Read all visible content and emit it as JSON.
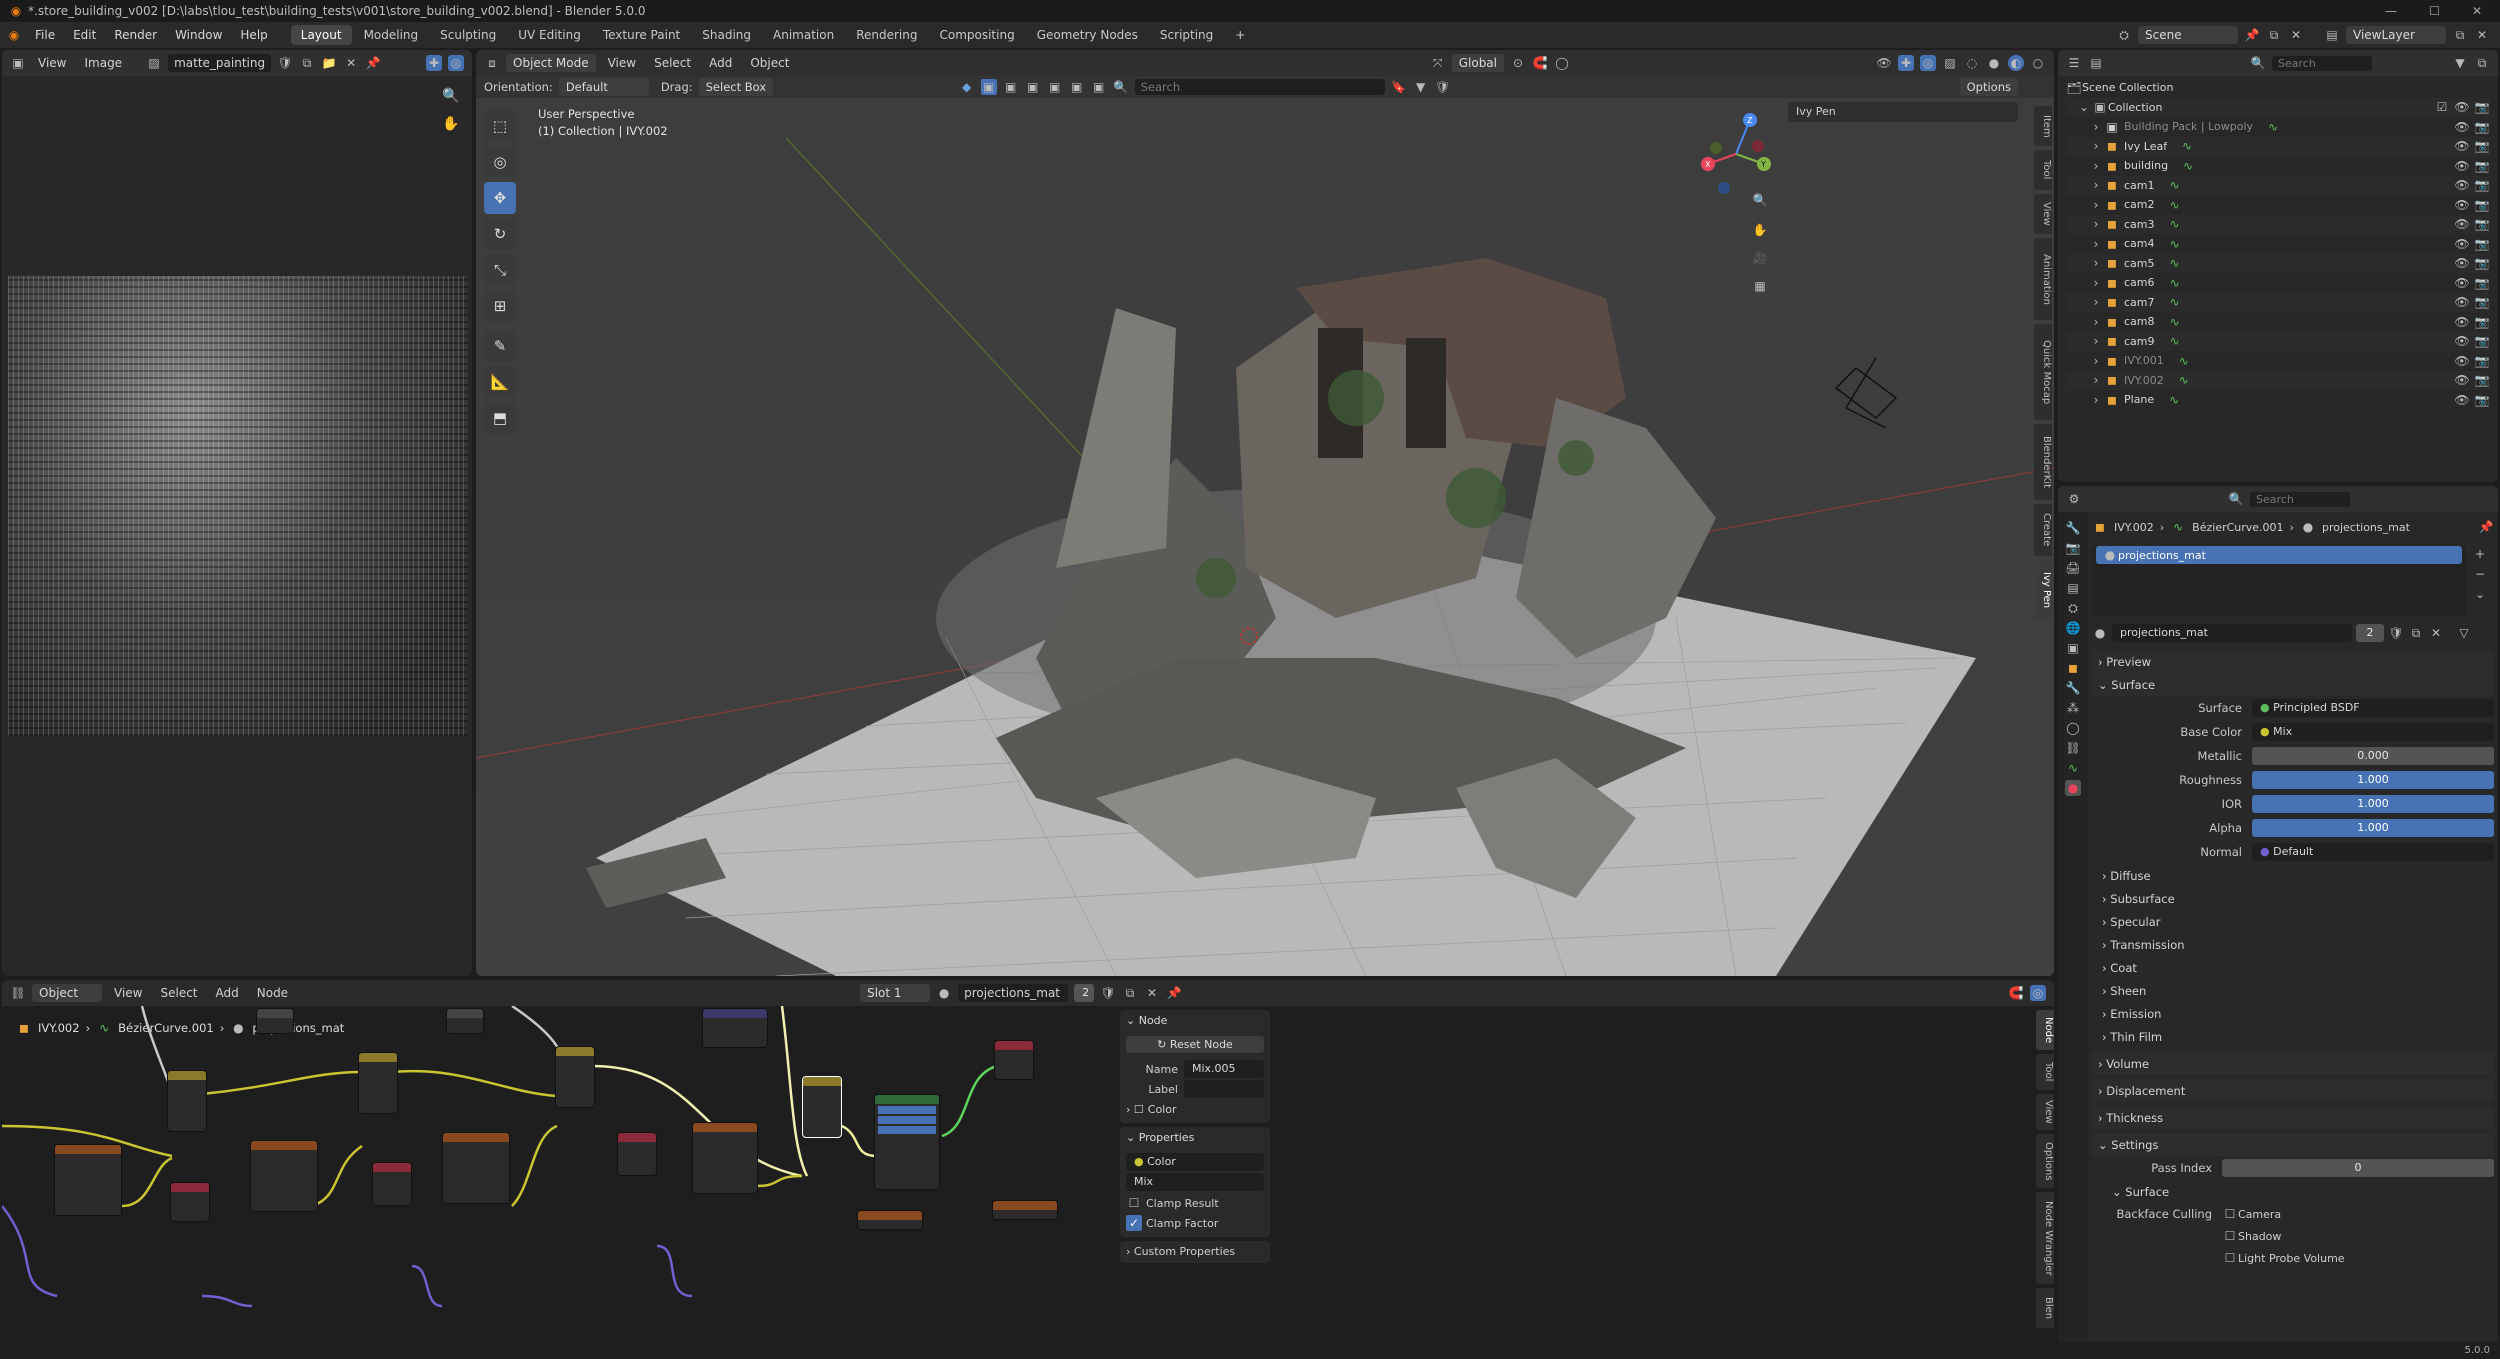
{
  "window": {
    "title": "*.store_building_v002 [D:\\labs\\tlou_test\\building_tests\\v001\\store_building_v002.blend] - Blender 5.0.0",
    "version": "5.0.0"
  },
  "menu": [
    "File",
    "Edit",
    "Render",
    "Window",
    "Help"
  ],
  "workspaces": [
    "Layout",
    "Modeling",
    "Sculpting",
    "UV Editing",
    "Texture Paint",
    "Shading",
    "Animation",
    "Rendering",
    "Compositing",
    "Geometry Nodes",
    "Scripting"
  ],
  "active_workspace": "Layout",
  "scene": {
    "name": "Scene",
    "view_layer": "ViewLayer"
  },
  "image_editor": {
    "view": "View",
    "image": "Image",
    "image_name": "matte_painting"
  },
  "viewport": {
    "mode": "Object Mode",
    "menus": [
      "View",
      "Select",
      "Add",
      "Object"
    ],
    "orientation_label": "Orientation:",
    "orientation": "Default",
    "drag_label": "Drag:",
    "drag": "Select Box",
    "transform": "Global",
    "search_placeholder": "Search",
    "options": "Options",
    "overlay_line1": "User Perspective",
    "overlay_line2": "(1) Collection | IVY.002",
    "npanel_title": "Ivy Pen",
    "side_tabs": [
      "Item",
      "Tool",
      "View",
      "Animation",
      "Quick Mocap",
      "BlenderKit",
      "Create",
      "Ivy Pen"
    ]
  },
  "outliner": {
    "search_placeholder": "Search",
    "root": "Scene Collection",
    "collection": "Collection",
    "items": [
      {
        "name": "Building Pack | Lowpoly",
        "dim": true
      },
      {
        "name": "Ivy Leaf",
        "dim": false
      },
      {
        "name": "building",
        "dim": false
      },
      {
        "name": "cam1",
        "dim": false
      },
      {
        "name": "cam2",
        "dim": false
      },
      {
        "name": "cam3",
        "dim": false
      },
      {
        "name": "cam4",
        "dim": false
      },
      {
        "name": "cam5",
        "dim": false
      },
      {
        "name": "cam6",
        "dim": false
      },
      {
        "name": "cam7",
        "dim": false
      },
      {
        "name": "cam8",
        "dim": false
      },
      {
        "name": "cam9",
        "dim": false
      },
      {
        "name": "IVY.001",
        "dim": true
      },
      {
        "name": "IVY.002",
        "dim": true
      },
      {
        "name": "Plane",
        "dim": false
      }
    ]
  },
  "properties": {
    "search_placeholder": "Search",
    "breadcrumb": [
      "IVY.002",
      "BézierCurve.001",
      "projections_mat"
    ],
    "slot_material": "projections_mat",
    "material_name": "projections_mat",
    "users": "2",
    "sections": {
      "preview": "Preview",
      "surface": "Surface",
      "diffuse": "Diffuse",
      "subsurface": "Subsurface",
      "specular": "Specular",
      "transmission": "Transmission",
      "coat": "Coat",
      "sheen": "Sheen",
      "emission": "Emission",
      "thin_film": "Thin Film",
      "volume": "Volume",
      "displacement": "Displacement",
      "thickness": "Thickness",
      "settings": "Settings",
      "settings_surface": "Surface"
    },
    "fields": {
      "surface_label": "Surface",
      "surface_value": "Principled BSDF",
      "base_color_label": "Base Color",
      "base_color_value": "Mix",
      "metallic_label": "Metallic",
      "metallic_value": "0.000",
      "roughness_label": "Roughness",
      "roughness_value": "1.000",
      "ior_label": "IOR",
      "ior_value": "1.000",
      "alpha_label": "Alpha",
      "alpha_value": "1.000",
      "normal_label": "Normal",
      "normal_value": "Default",
      "pass_index_label": "Pass Index",
      "pass_index_value": "0",
      "backface_label": "Backface Culling",
      "camera": "Camera",
      "shadow": "Shadow",
      "light_probe": "Light Probe Volume"
    }
  },
  "node_editor": {
    "mode": "Object",
    "menus": [
      "View",
      "Select",
      "Add",
      "Node"
    ],
    "slot": "Slot 1",
    "material": "projections_mat",
    "users": "2",
    "breadcrumb": [
      "IVY.002",
      "BézierCurve.001",
      "projections_mat"
    ],
    "side_tabs": [
      "Node",
      "Tool",
      "View",
      "Options",
      "Node Wrangler",
      "Blen"
    ],
    "panel": {
      "node_header": "Node",
      "reset": "Reset Node",
      "name_label": "Name",
      "name_value": "Mix.005",
      "label_label": "Label",
      "color_label": "Color",
      "properties_header": "Properties",
      "data_type": "Color",
      "blend": "Mix",
      "clamp_result": "Clamp Result",
      "clamp_factor": "Clamp Factor",
      "custom_props": "Custom Properties"
    }
  },
  "colors": {
    "accent": "#4772b3",
    "orange_object": "#e8a23a",
    "green_data": "#5fbf5f",
    "node_yellow_wire": "#c9c531",
    "node_green_wire": "#5ed35e",
    "node_purple_wire": "#7060d0"
  }
}
